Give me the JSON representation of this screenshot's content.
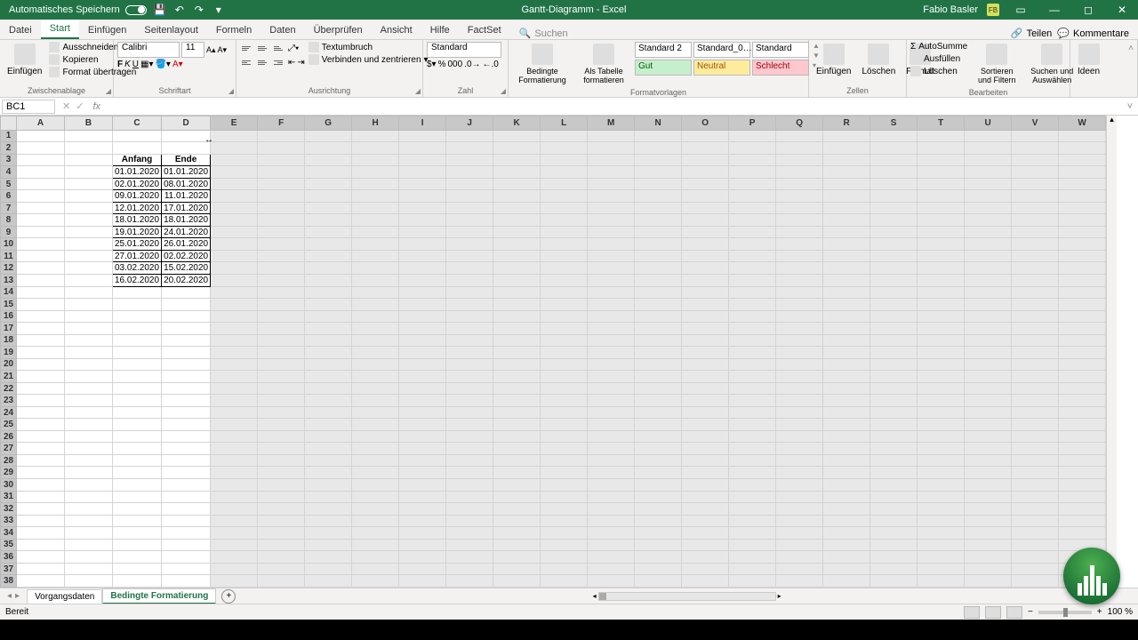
{
  "title": {
    "doc": "Gantt-Diagramm",
    "app": "Excel"
  },
  "autosave": "Automatisches Speichern",
  "user": {
    "name": "Fabio Basler",
    "initials": "FB"
  },
  "tabs": [
    "Datei",
    "Start",
    "Einfügen",
    "Seitenlayout",
    "Formeln",
    "Daten",
    "Überprüfen",
    "Ansicht",
    "Hilfe",
    "FactSet"
  ],
  "active_tab": "Start",
  "search_placeholder": "Suchen",
  "share": "Teilen",
  "comments": "Kommentare",
  "ribbon": {
    "clipboard": {
      "label": "Zwischenablage",
      "paste": "Einfügen",
      "cut": "Ausschneiden",
      "copy": "Kopieren",
      "fmt": "Format übertragen"
    },
    "font": {
      "label": "Schriftart",
      "name": "Calibri",
      "size": "11"
    },
    "align": {
      "label": "Ausrichtung",
      "wrap": "Textumbruch",
      "merge": "Verbinden und zentrieren"
    },
    "number": {
      "label": "Zahl",
      "fmt": "Standard"
    },
    "styles": {
      "label": "Formatvorlagen",
      "cond": "Bedingte Formatierung",
      "table": "Als Tabelle formatieren",
      "s1": "Standard 2",
      "s2": "Standard_0…",
      "s3": "Standard",
      "good": "Gut",
      "neutral": "Neutral",
      "bad": "Schlecht"
    },
    "cells": {
      "label": "Zellen",
      "insert": "Einfügen",
      "delete": "Löschen",
      "format": "Format"
    },
    "editing": {
      "label": "Bearbeiten",
      "sum": "AutoSumme",
      "fill": "Ausfüllen",
      "clear": "Löschen",
      "sort": "Sortieren und Filtern",
      "find": "Suchen und Auswählen"
    },
    "ideas": "Ideen"
  },
  "name_box": "BC1",
  "columns": [
    "A",
    "B",
    "C",
    "D",
    "E",
    "F",
    "G",
    "H",
    "I",
    "J",
    "K",
    "L",
    "M",
    "N",
    "O",
    "P",
    "Q",
    "R",
    "S",
    "T",
    "U",
    "V",
    "W"
  ],
  "table": {
    "headers": [
      "Anfang",
      "Ende"
    ],
    "rows": [
      [
        "01.01.2020",
        "01.01.2020"
      ],
      [
        "02.01.2020",
        "08.01.2020"
      ],
      [
        "09.01.2020",
        "11.01.2020"
      ],
      [
        "12.01.2020",
        "17.01.2020"
      ],
      [
        "18.01.2020",
        "18.01.2020"
      ],
      [
        "19.01.2020",
        "24.01.2020"
      ],
      [
        "25.01.2020",
        "26.01.2020"
      ],
      [
        "27.01.2020",
        "02.02.2020"
      ],
      [
        "03.02.2020",
        "15.02.2020"
      ],
      [
        "16.02.2020",
        "20.02.2020"
      ]
    ]
  },
  "sheets": [
    "Vorgangsdaten",
    "Bedingte Formatierung"
  ],
  "active_sheet": "Bedingte Formatierung",
  "status": "Bereit",
  "zoom": "100 %"
}
